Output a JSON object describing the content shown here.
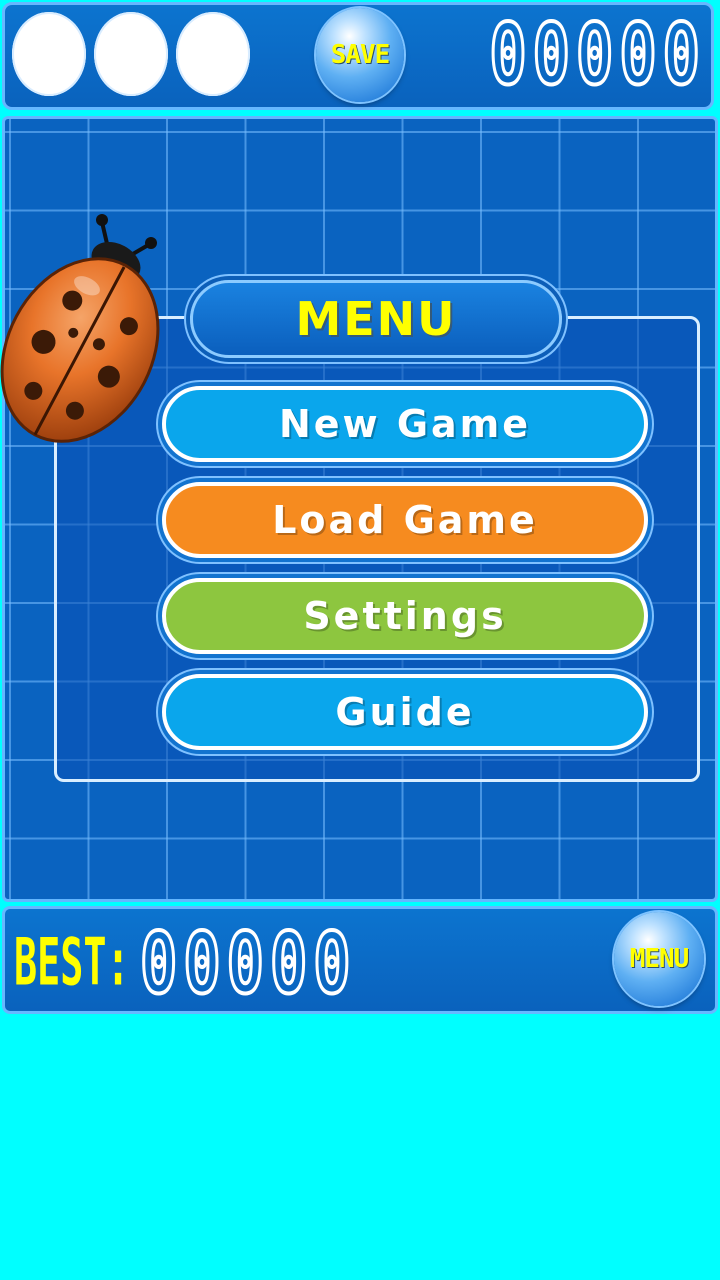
{
  "header": {
    "lives": [
      "",
      "",
      ""
    ],
    "save_label": "SAVE",
    "score": "00000"
  },
  "menu": {
    "title": "MENU",
    "buttons": [
      {
        "id": "new-game",
        "label": "New Game",
        "color": "#0aa6ec"
      },
      {
        "id": "load-game",
        "label": "Load Game",
        "color": "#f68b1f"
      },
      {
        "id": "settings",
        "label": "Settings",
        "color": "#8dc63f"
      },
      {
        "id": "guide",
        "label": "Guide",
        "color": "#0aa6ec"
      }
    ]
  },
  "footer": {
    "best_label": "BEST:",
    "best_score": "00000",
    "menu_label": "MENU"
  },
  "colors": {
    "background": "#00ffff",
    "board": "#0a63c0",
    "title_text": "#ffff00",
    "ladybug": "#e8742a"
  },
  "icons": {
    "mascot": "ladybug-icon"
  }
}
